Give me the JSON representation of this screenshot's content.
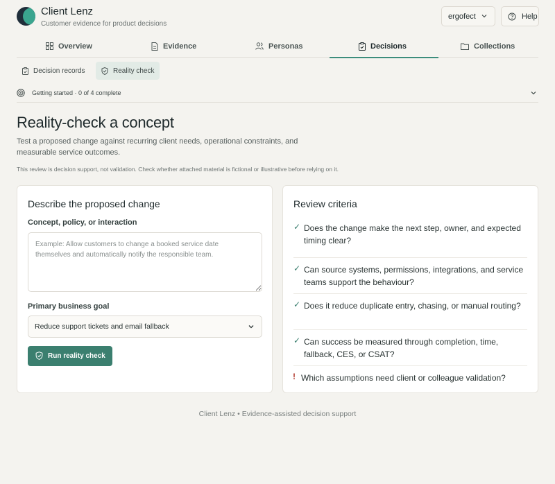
{
  "app": {
    "title": "Client Lenz",
    "subtitle": "Customer evidence for product decisions",
    "workspace": "ergofect",
    "help_label": "Help"
  },
  "tabs": [
    {
      "label": "Overview",
      "icon": "grid-icon"
    },
    {
      "label": "Evidence",
      "icon": "document-icon"
    },
    {
      "label": "Personas",
      "icon": "users-icon"
    },
    {
      "label": "Decisions",
      "icon": "clipboard-icon",
      "active": true
    },
    {
      "label": "Collections",
      "icon": "folder-icon"
    }
  ],
  "subtabs": [
    {
      "label": "Decision records",
      "icon": "clipboard-icon"
    },
    {
      "label": "Reality check",
      "icon": "shield-check-icon",
      "active": true
    }
  ],
  "getting_started": {
    "text": "Getting started · 0 of 4 complete"
  },
  "page": {
    "title": "Reality-check a concept",
    "description": "Test a proposed change against recurring client needs, operational constraints, and measurable service outcomes.",
    "disclaimer": "This review is decision support, not validation. Check whether attached material is fictional or illustrative before relying on it."
  },
  "form": {
    "title": "Describe the proposed change",
    "concept_label": "Concept, policy, or interaction",
    "concept_placeholder": "Example: Allow customers to change a booked service date themselves and automatically notify the responsible team.",
    "concept_value": "",
    "goal_label": "Primary business goal",
    "goal_value": "Reduce support tickets and email fallback",
    "run_label": "Run reality check"
  },
  "review": {
    "title": "Review criteria",
    "items": [
      {
        "mark": "✓",
        "type": "check",
        "text": "Does the change make the next step, owner, and expected timing clear?"
      },
      {
        "mark": "✓",
        "type": "check",
        "text": "Can source systems, permissions, integrations, and service teams support the behaviour?"
      },
      {
        "mark": "✓",
        "type": "check",
        "text": "Does it reduce duplicate entry, chasing, or manual routing?"
      },
      {
        "mark": "✓",
        "type": "check",
        "text": "Can success be measured through completion, time, fallback, CES, or CSAT?"
      },
      {
        "mark": "!",
        "type": "warn",
        "text": "Which assumptions need client or colleague validation?"
      }
    ]
  },
  "footer": {
    "text": "Client Lenz • Evidence-assisted decision support"
  },
  "colors": {
    "accent": "#3b7f6f",
    "background": "#f4f3ef",
    "warn": "#b23a2e"
  }
}
